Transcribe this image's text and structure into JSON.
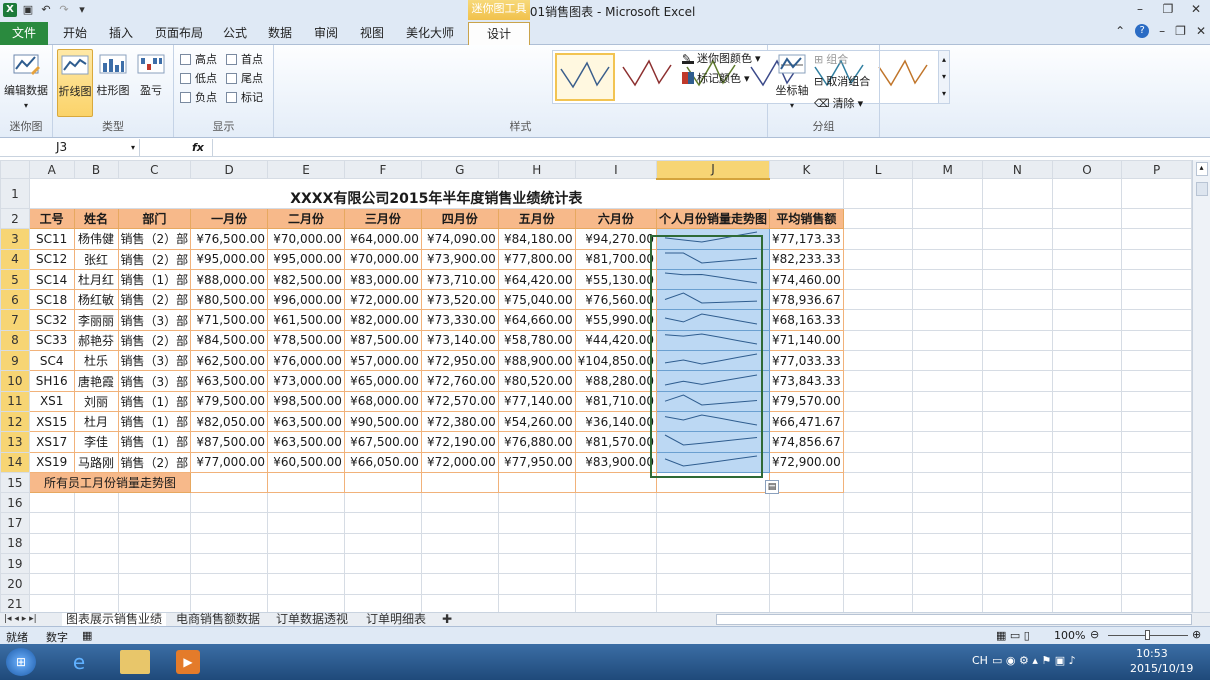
{
  "window": {
    "title": "0901销售图表 - Microsoft Excel",
    "context_tool": "迷你图工具"
  },
  "tabs": [
    "文件",
    "开始",
    "插入",
    "页面布局",
    "公式",
    "数据",
    "审阅",
    "视图",
    "美化大师",
    "设计"
  ],
  "ribbon": {
    "group_sparkline": {
      "label": "迷你图",
      "edit_data": "编辑数据"
    },
    "group_type": {
      "label": "类型",
      "line": "折线图",
      "column": "柱形图",
      "winloss": "盈亏"
    },
    "group_show": {
      "label": "显示",
      "options": [
        "高点",
        "首点",
        "低点",
        "尾点",
        "负点",
        "标记"
      ]
    },
    "group_style": {
      "label": "样式",
      "sparkline_color": "迷你图颜色",
      "marker_color": "标记颜色"
    },
    "group_group": {
      "label": "分组",
      "axis": "坐标轴",
      "group": "组合",
      "ungroup": "取消组合",
      "clear": "清除"
    },
    "style_colors": [
      "#3a5e8c",
      "#8c2f2f",
      "#5e7a2a",
      "#3b4a8a",
      "#2f7ea0",
      "#c0752a"
    ]
  },
  "formula_bar": {
    "name_box": "J3",
    "fx": "fx",
    "formula": ""
  },
  "columns": [
    "A",
    "B",
    "C",
    "D",
    "E",
    "F",
    "G",
    "H",
    "I",
    "J",
    "K",
    "L",
    "M",
    "N",
    "O",
    "P"
  ],
  "sheet": {
    "title": "XXXX有限公司2015年半年度销售业绩统计表",
    "headers": [
      "工号",
      "姓名",
      "部门",
      "一月份",
      "二月份",
      "三月份",
      "四月份",
      "五月份",
      "六月份",
      "个人月份销量走势图",
      "平均销售额"
    ],
    "rows": [
      {
        "id": "SC11",
        "name": "杨伟健",
        "dept": "销售（2）部",
        "m": [
          "¥76,500.00",
          "¥70,000.00",
          "¥64,000.00",
          "¥74,090.00",
          "¥84,180.00",
          "¥94,270.00"
        ],
        "vals": [
          76500,
          70000,
          64000,
          74090,
          84180,
          94270
        ],
        "avg": "¥77,173.33"
      },
      {
        "id": "SC12",
        "name": "张红",
        "dept": "销售（2）部",
        "m": [
          "¥95,000.00",
          "¥95,000.00",
          "¥70,000.00",
          "¥73,900.00",
          "¥77,800.00",
          "¥81,700.00"
        ],
        "vals": [
          95000,
          95000,
          70000,
          73900,
          77800,
          81700
        ],
        "avg": "¥82,233.33"
      },
      {
        "id": "SC14",
        "name": "杜月红",
        "dept": "销售（1）部",
        "m": [
          "¥88,000.00",
          "¥82,500.00",
          "¥83,000.00",
          "¥73,710.00",
          "¥64,420.00",
          "¥55,130.00"
        ],
        "vals": [
          88000,
          82500,
          83000,
          73710,
          64420,
          55130
        ],
        "avg": "¥74,460.00"
      },
      {
        "id": "SC18",
        "name": "杨红敏",
        "dept": "销售（2）部",
        "m": [
          "¥80,500.00",
          "¥96,000.00",
          "¥72,000.00",
          "¥73,520.00",
          "¥75,040.00",
          "¥76,560.00"
        ],
        "vals": [
          80500,
          96000,
          72000,
          73520,
          75040,
          76560
        ],
        "avg": "¥78,936.67"
      },
      {
        "id": "SC32",
        "name": "李丽丽",
        "dept": "销售（3）部",
        "m": [
          "¥71,500.00",
          "¥61,500.00",
          "¥82,000.00",
          "¥73,330.00",
          "¥64,660.00",
          "¥55,990.00"
        ],
        "vals": [
          71500,
          61500,
          82000,
          73330,
          64660,
          55990
        ],
        "avg": "¥68,163.33"
      },
      {
        "id": "SC33",
        "name": "郝艳芬",
        "dept": "销售（2）部",
        "m": [
          "¥84,500.00",
          "¥78,500.00",
          "¥87,500.00",
          "¥73,140.00",
          "¥58,780.00",
          "¥44,420.00"
        ],
        "vals": [
          84500,
          78500,
          87500,
          73140,
          58780,
          44420
        ],
        "avg": "¥71,140.00"
      },
      {
        "id": "SC4",
        "name": "杜乐",
        "dept": "销售（3）部",
        "m": [
          "¥62,500.00",
          "¥76,000.00",
          "¥57,000.00",
          "¥72,950.00",
          "¥88,900.00",
          "¥104,850.00"
        ],
        "vals": [
          62500,
          76000,
          57000,
          72950,
          88900,
          104850
        ],
        "avg": "¥77,033.33"
      },
      {
        "id": "SH16",
        "name": "唐艳霞",
        "dept": "销售（3）部",
        "m": [
          "¥63,500.00",
          "¥73,000.00",
          "¥65,000.00",
          "¥72,760.00",
          "¥80,520.00",
          "¥88,280.00"
        ],
        "vals": [
          63500,
          73000,
          65000,
          72760,
          80520,
          88280
        ],
        "avg": "¥73,843.33"
      },
      {
        "id": "XS1",
        "name": "刘丽",
        "dept": "销售（1）部",
        "m": [
          "¥79,500.00",
          "¥98,500.00",
          "¥68,000.00",
          "¥72,570.00",
          "¥77,140.00",
          "¥81,710.00"
        ],
        "vals": [
          79500,
          98500,
          68000,
          72570,
          77140,
          81710
        ],
        "avg": "¥79,570.00"
      },
      {
        "id": "XS15",
        "name": "杜月",
        "dept": "销售（1）部",
        "m": [
          "¥82,050.00",
          "¥63,500.00",
          "¥90,500.00",
          "¥72,380.00",
          "¥54,260.00",
          "¥36,140.00"
        ],
        "vals": [
          82050,
          63500,
          90500,
          72380,
          54260,
          36140
        ],
        "avg": "¥66,471.67"
      },
      {
        "id": "XS17",
        "name": "李佳",
        "dept": "销售（1）部",
        "m": [
          "¥87,500.00",
          "¥63,500.00",
          "¥67,500.00",
          "¥72,190.00",
          "¥76,880.00",
          "¥81,570.00"
        ],
        "vals": [
          87500,
          63500,
          67500,
          72190,
          76880,
          81570
        ],
        "avg": "¥74,856.67"
      },
      {
        "id": "XS19",
        "name": "马路刚",
        "dept": "销售（2）部",
        "m": [
          "¥77,000.00",
          "¥60,500.00",
          "¥66,050.00",
          "¥72,000.00",
          "¥77,950.00",
          "¥83,900.00"
        ],
        "vals": [
          77000,
          60500,
          66050,
          72000,
          77950,
          83900
        ],
        "avg": "¥72,900.00"
      }
    ],
    "footer_label": "所有员工月份销量走势图"
  },
  "sheet_tabs": [
    "图表展示销售业绩",
    "电商销售额数据",
    "订单数据透视",
    "订单明细表"
  ],
  "status": {
    "ready": "就绪",
    "mode": "数字",
    "zoom": "100%"
  },
  "taskbar": {
    "lang": "CH",
    "time": "10:53",
    "date": "2015/10/19"
  },
  "colors": {
    "header_fill": "#f7b98a",
    "sparkline_fill": "#bcd8f3",
    "sparkline_line": "#2f5d8f",
    "selection": "#2f6a36"
  }
}
